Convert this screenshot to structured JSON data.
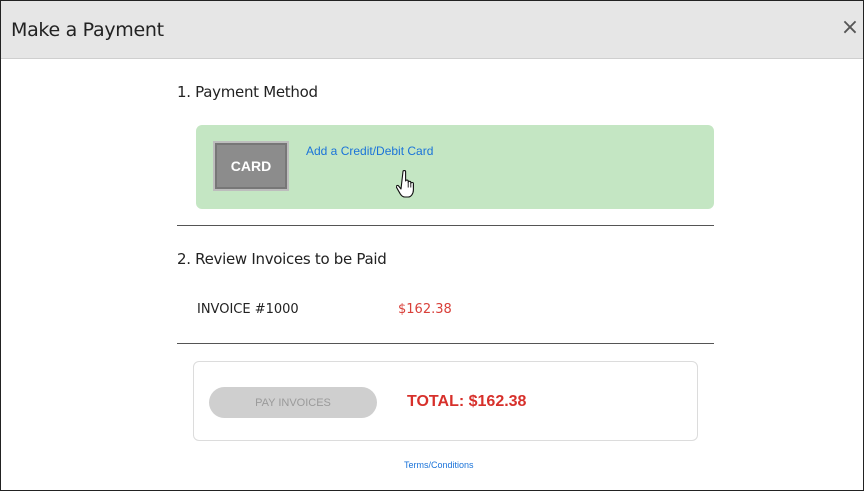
{
  "modal": {
    "title": "Make a Payment",
    "close_symbol": "×"
  },
  "payment_method": {
    "heading": "1. Payment Method",
    "card_icon_label": "CARD",
    "add_card_link": "Add a Credit/Debit Card",
    "box_color": "#c4e6c3"
  },
  "review": {
    "heading": "2. Review Invoices to be Paid",
    "invoices": [
      {
        "label": "INVOICE #1000",
        "amount": "$162.38"
      }
    ]
  },
  "payment": {
    "pay_button": "PAY INVOICES",
    "total": "TOTAL: $162.38"
  },
  "terms_link": "Terms/Conditions",
  "colors": {
    "accent_link": "#1a73d9",
    "amount_red": "#d7302b"
  },
  "icons": {
    "close": "close-icon",
    "card": "credit-card-icon",
    "cursor": "hand-pointer-cursor-icon"
  }
}
